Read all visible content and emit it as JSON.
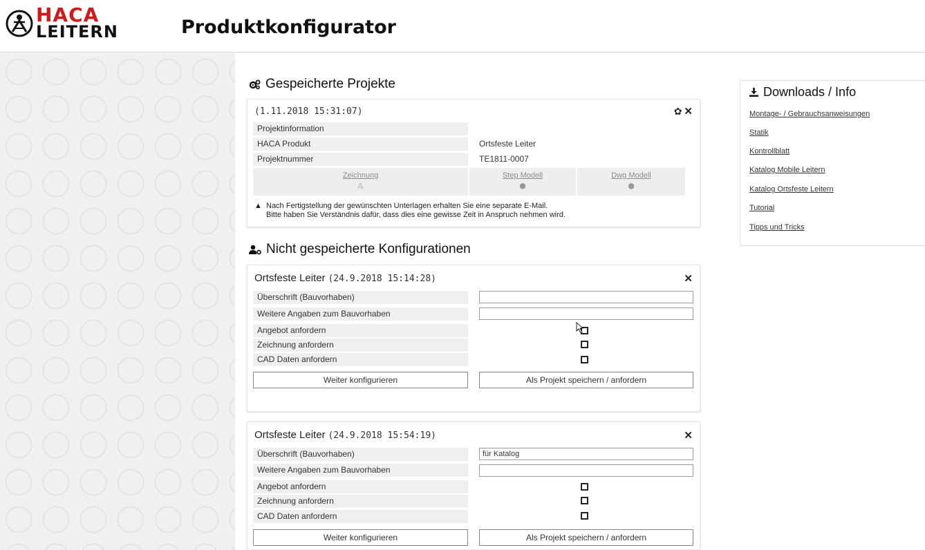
{
  "header": {
    "brand_top": "HACA",
    "brand_bottom": "LEITERN",
    "title": "Produktkonfigurator"
  },
  "saved_projects": {
    "section_title": "Gespeicherte Projekte",
    "project": {
      "timestamp": "(1.11.2018 15:31:07)",
      "rows": [
        {
          "label": "Projektinformation",
          "value": ""
        },
        {
          "label": "HACA Produkt",
          "value": "Ortsfeste Leiter"
        },
        {
          "label": "Projektnummer",
          "value": "TE1811-0007"
        }
      ],
      "downloads": [
        {
          "label": "Zeichnung",
          "icon": "drawing-icon"
        },
        {
          "label": "Step Modell",
          "icon": "cube-icon"
        },
        {
          "label": "Dwg Modell",
          "icon": "cube-icon"
        }
      ],
      "notice_line1": "Nach Fertigstellung der gewünschten Unterlagen erhalten Sie eine separate E-Mail.",
      "notice_line2": "Bitte haben Sie Verständnis dafür, dass dies eine gewisse Zeit in Anspruch nehmen wird."
    }
  },
  "unsaved": {
    "section_title": "Nicht gespeicherte Konfigurationen",
    "configs": [
      {
        "name": "Ortsfeste Leiter",
        "date": "(24.9.2018 15:14:28)",
        "heading_label": "Überschrift (Bauvorhaben)",
        "heading_value": "",
        "details_label": "Weitere Angaben zum Bauvorhaben",
        "details_value": "",
        "offer_label": "Angebot anfordern",
        "drawing_label": "Zeichnung anfordern",
        "cad_label": "CAD Daten anfordern",
        "continue_label": "Weiter konfigurieren",
        "save_label": "Als Projekt speichern / anfordern"
      },
      {
        "name": "Ortsfeste Leiter",
        "date": "(24.9.2018 15:54:19)",
        "heading_label": "Überschrift (Bauvorhaben)",
        "heading_value": "für Katalog",
        "details_label": "Weitere Angaben zum Bauvorhaben",
        "details_value": "",
        "offer_label": "Angebot anfordern",
        "drawing_label": "Zeichnung anfordern",
        "cad_label": "CAD Daten anfordern",
        "continue_label": "Weiter konfigurieren",
        "save_label": "Als Projekt speichern / anfordern"
      }
    ]
  },
  "sidebar": {
    "title": "Downloads / Info",
    "links": [
      "Montage- / Gebrauchsanweisungen",
      "Statik",
      "Kontrollblatt",
      "Katalog Mobile Leitern",
      "Katalog Ortsfeste Leitern",
      "Tutorial",
      "Tipps und Tricks"
    ]
  },
  "colors": {
    "brand_red": "#d21a1a",
    "text": "#222222",
    "row_bg": "#efefef"
  }
}
